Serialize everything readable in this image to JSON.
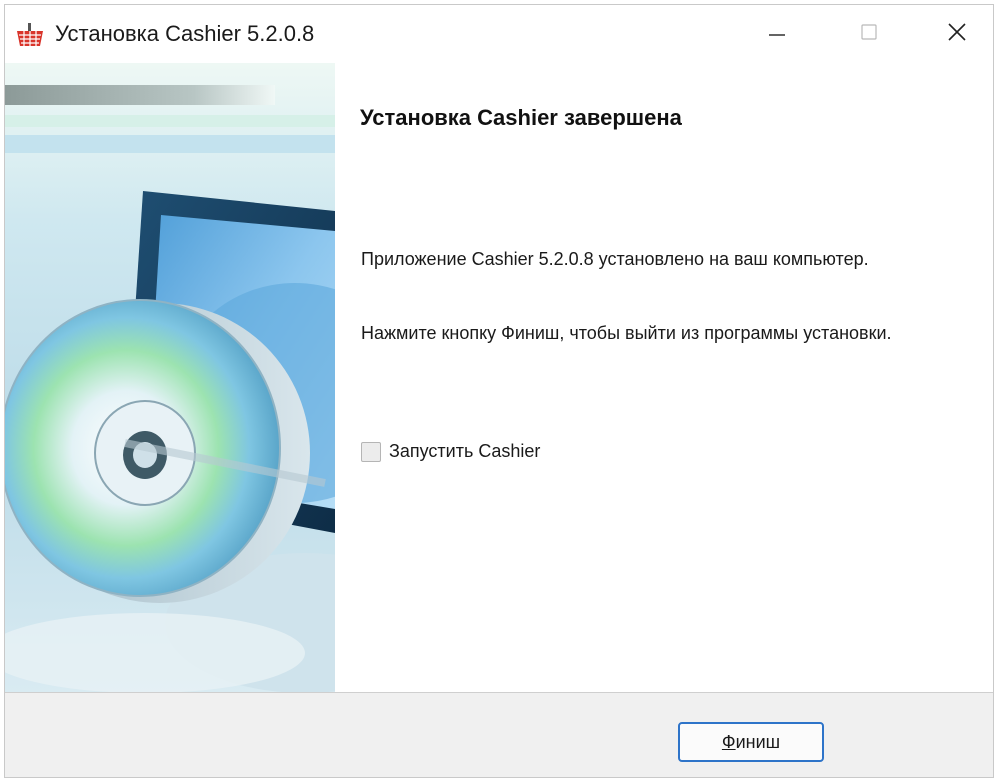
{
  "window": {
    "title": "Установка Cashier 5.2.0.8",
    "app_icon": "basket-icon"
  },
  "controls": {
    "minimize_icon": "minimize-icon",
    "maximize_icon": "maximize-icon",
    "close_icon": "close-icon"
  },
  "content": {
    "heading": "Установка Cashier завершена",
    "paragraph_installed": "Приложение Cashier 5.2.0.8 установлено на ваш компьютер.",
    "paragraph_finish": "Нажмите кнопку Финиш, чтобы выйти из программы установки.",
    "checkbox_label": "Запустить Cashier",
    "checkbox_checked": false
  },
  "footer": {
    "finish_button_accel": "Ф",
    "finish_button_rest": "иниш"
  },
  "colors": {
    "accent": "#2e74c9",
    "footer_bg": "#f0f0f0"
  }
}
